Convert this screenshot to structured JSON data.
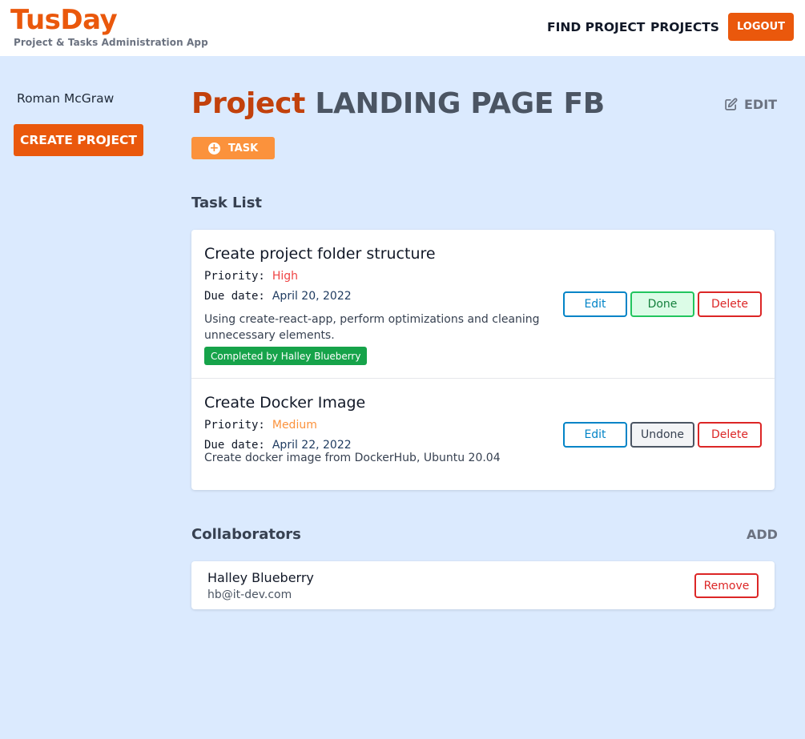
{
  "header": {
    "brand": "TusDay",
    "tagline": "Project & Tasks Administration App",
    "nav": {
      "find_project": "FIND PROJECT",
      "projects": "PROJECTS",
      "logout": "LOGOUT"
    }
  },
  "sidebar": {
    "user_name": "Roman McGraw",
    "create_project": "CREATE PROJECT"
  },
  "project": {
    "title_prefix": "Project",
    "name": "LANDING PAGE FB",
    "edit_label": "EDIT",
    "add_task_label": "TASK"
  },
  "task_list": {
    "title": "Task List",
    "priority_label": "Priority:",
    "due_label": "Due date:",
    "tasks": [
      {
        "title": "Create project folder structure",
        "priority": "High",
        "due_date": "April 20, 2022",
        "description": "Using create-react-app, perform optimizations and cleaning unnecessary elements.",
        "badge": "Completed by Halley Blueberry",
        "edit": "Edit",
        "toggle": "Done",
        "delete": "Delete"
      },
      {
        "title": "Create Docker Image",
        "priority": "Medium",
        "due_date": "April 22, 2022",
        "description": "Create docker image from DockerHub, Ubuntu 20.04",
        "edit": "Edit",
        "toggle": "Undone",
        "delete": "Delete"
      }
    ]
  },
  "collaborators": {
    "title": "Collaborators",
    "add_label": "ADD",
    "items": [
      {
        "name": "Halley Blueberry",
        "email": "hb@it-dev.com",
        "remove": "Remove"
      }
    ]
  },
  "colors": {
    "brand_orange": "#ea580c",
    "background": "#dbeafe",
    "priority_high": "#ef4444",
    "priority_medium": "#fb923c",
    "completed_badge": "#16a34a"
  },
  "icons": {
    "edit": "edit-square-icon",
    "add_task": "plus-circle-icon"
  }
}
